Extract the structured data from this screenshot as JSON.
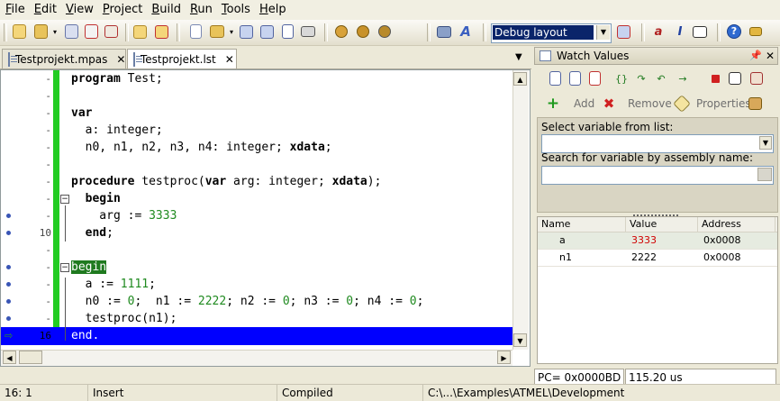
{
  "menu": [
    "File",
    "Edit",
    "View",
    "Project",
    "Build",
    "Run",
    "Tools",
    "Help"
  ],
  "toolbar": {
    "layout_value": "Debug layout"
  },
  "tabs": [
    {
      "label": "Testprojekt.mpas",
      "active": false
    },
    {
      "label": "Testprojekt.lst",
      "active": true
    }
  ],
  "editor": {
    "lines": [
      {
        "num": "-",
        "marker": "",
        "code": "program Test;"
      },
      {
        "num": "-",
        "marker": "",
        "code": ""
      },
      {
        "num": "-",
        "marker": "",
        "code": "var"
      },
      {
        "num": "-",
        "marker": "",
        "code": "  a: integer;"
      },
      {
        "num": "-",
        "marker": "",
        "code": "  n0, n1, n2, n3, n4: integer; xdata;"
      },
      {
        "num": "-",
        "marker": "",
        "code": ""
      },
      {
        "num": "-",
        "marker": "",
        "code": "procedure testproc(var arg: integer; xdata);"
      },
      {
        "num": "-",
        "marker": "",
        "code": "  begin"
      },
      {
        "num": "-",
        "marker": "breakpoint",
        "code": "    arg := 3333"
      },
      {
        "num": "10",
        "marker": "breakpoint",
        "code": "  end;"
      },
      {
        "num": "-",
        "marker": "",
        "code": ""
      },
      {
        "num": "-",
        "marker": "breakpoint",
        "code": "begin"
      },
      {
        "num": "-",
        "marker": "breakpoint",
        "code": "  a := 1111;"
      },
      {
        "num": "-",
        "marker": "breakpoint",
        "code": "  n0 := 0;  n1 := 2222; n2 := 0; n3 := 0; n4 := 0;"
      },
      {
        "num": "-",
        "marker": "breakpoint",
        "code": "  testproc(n1);"
      },
      {
        "num": "16",
        "marker": "current",
        "code": "end."
      }
    ]
  },
  "watch": {
    "title": "Watch Values",
    "add_label": "Add",
    "remove_label": "Remove",
    "properties_label": "Properties",
    "select_label": "Select variable from list:",
    "search_label": "Search for variable by assembly name:",
    "columns": [
      "Name",
      "Value",
      "Address"
    ],
    "rows": [
      {
        "name": "a",
        "value": "3333",
        "address": "0x0008"
      },
      {
        "name": "n1",
        "value": "2222",
        "address": "0x0008"
      }
    ],
    "pc": "PC= 0x0000BD",
    "time": "115.20 us"
  },
  "status": {
    "position": "16: 1",
    "mode": "Insert",
    "state": "Compiled",
    "path": "C:\\...\\Examples\\ATMEL\\Development"
  },
  "colors": {
    "gutter_bar": "#22cc22",
    "current_line": "#0000ff",
    "changed_value": "#d00000",
    "number_literal": "#1f8a1f"
  }
}
